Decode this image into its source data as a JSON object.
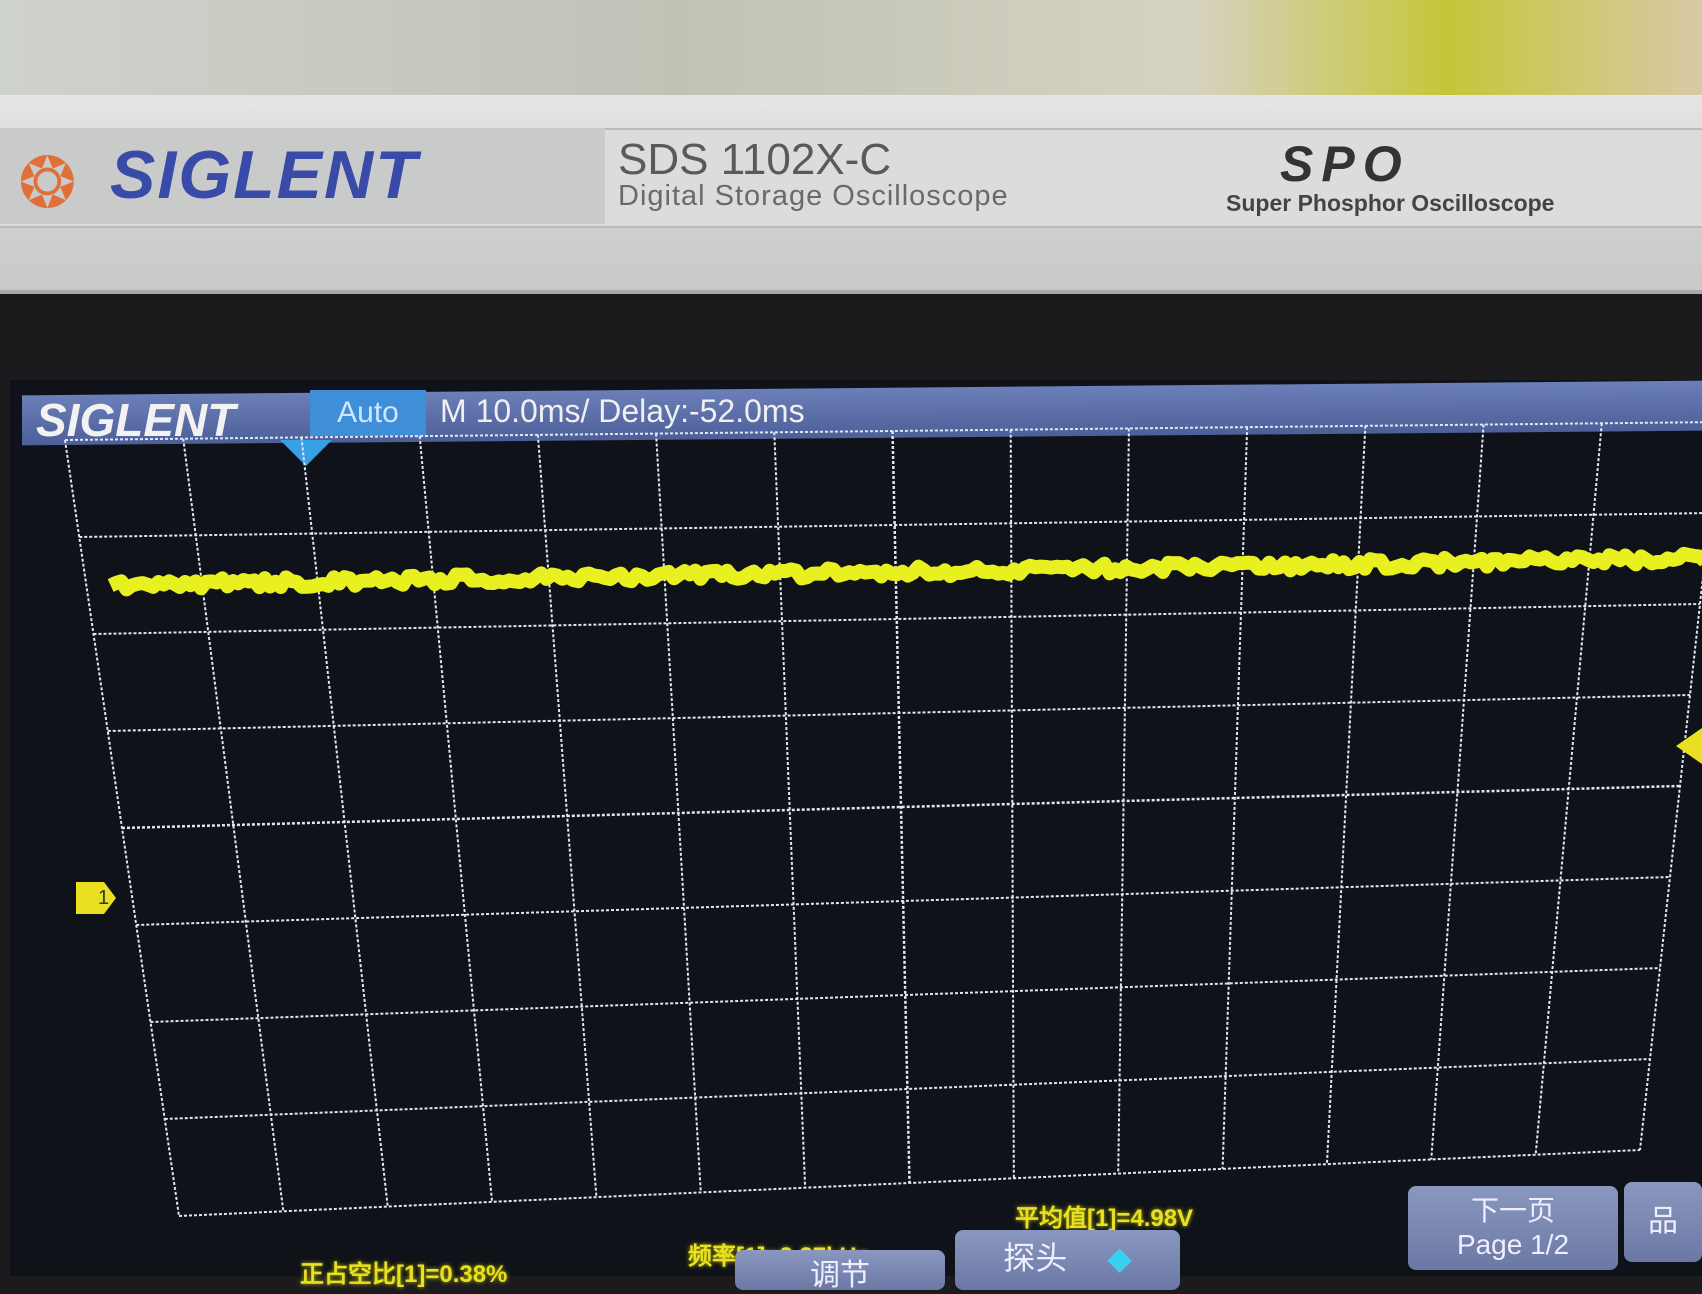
{
  "bezel": {
    "brand": "SIGLENT",
    "model": "SDS 1102X-C",
    "model_description": "Digital Storage Oscilloscope",
    "spo_logo": "SPO",
    "spo_description": "Super Phosphor Oscilloscope"
  },
  "screen": {
    "logo": "SIGLENT",
    "trigger_mode": "Auto",
    "timebase": "M 10.0ms/ Delay:-52.0ms",
    "channel_marker": "1",
    "trace_color": "#e8f020",
    "grid_color": "#dfe6f5",
    "grid": {
      "horizontal_divisions": 14,
      "vertical_divisions": 8
    },
    "measurements": {
      "duty": "正占空比[1]=0.38%",
      "frequency": "频率[1]=2.37kHz",
      "mean": "平均值[1]=4.98V"
    },
    "menu": {
      "adjust": "调节",
      "probe": "探头",
      "next_page": "下一页",
      "page": "Page 1/2",
      "network_icon": "network-icon"
    }
  }
}
